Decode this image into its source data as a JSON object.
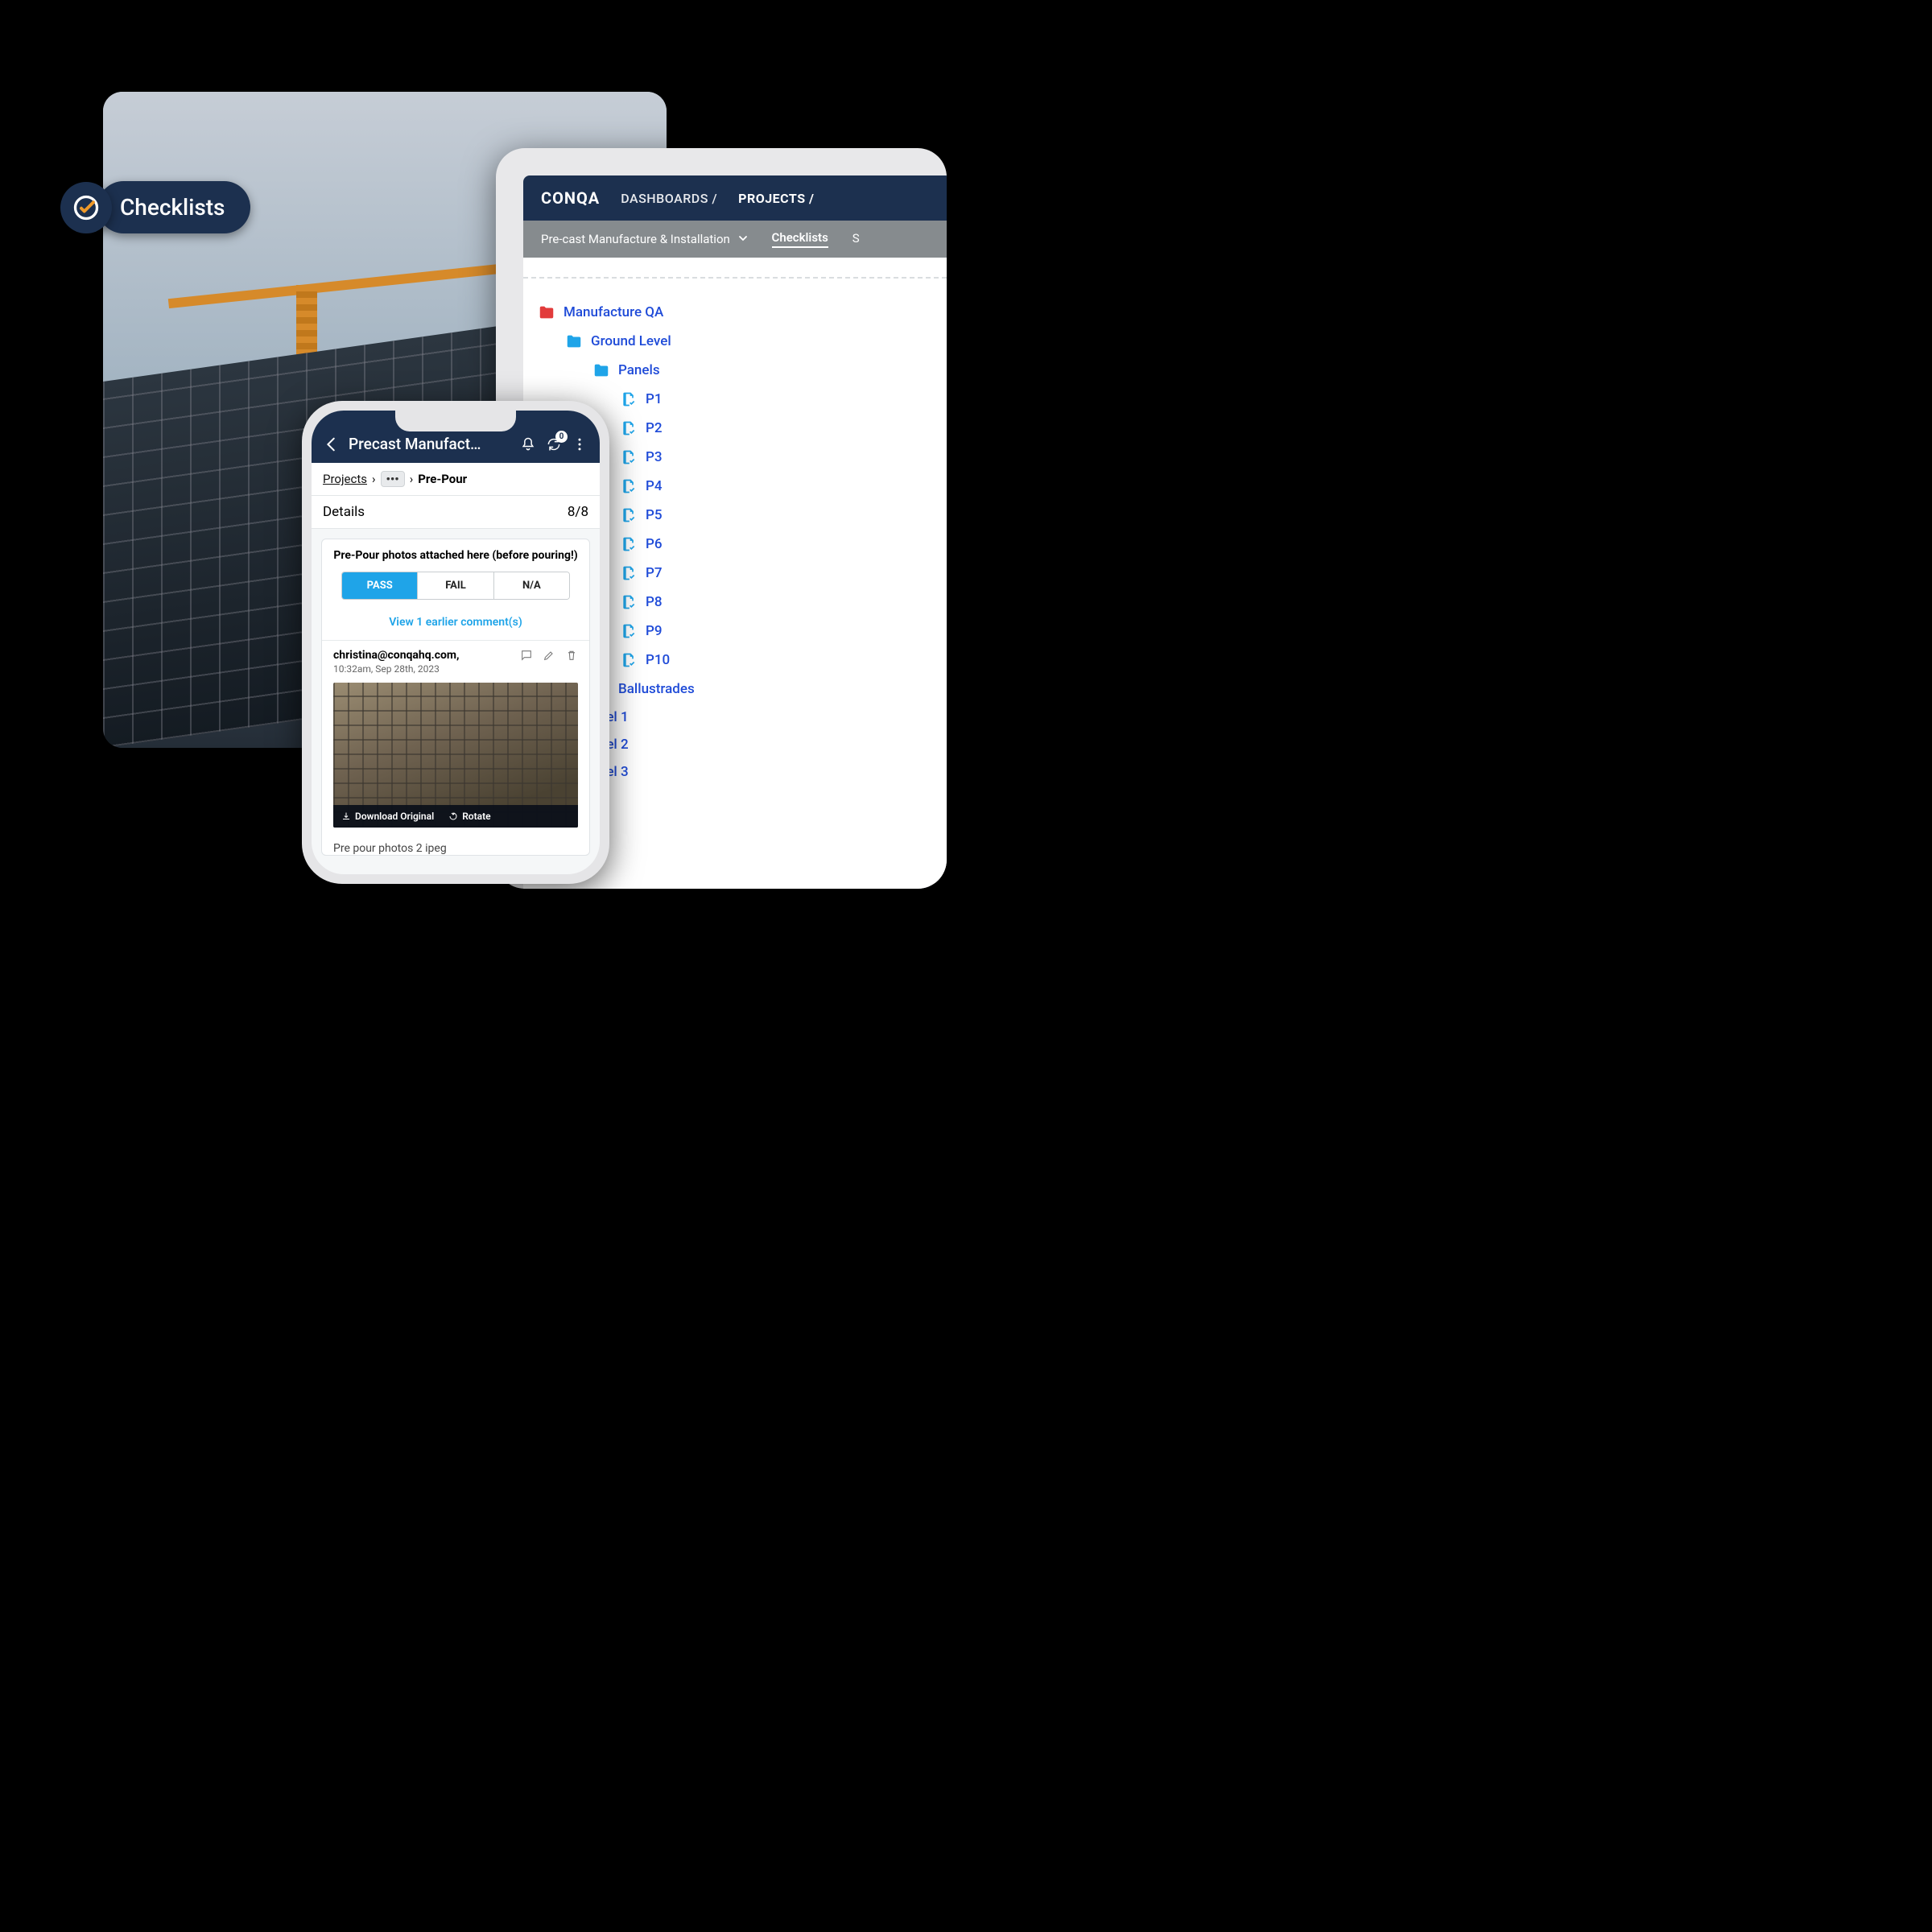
{
  "badge": {
    "label": "Checklists"
  },
  "tablet": {
    "logo": "CONQA",
    "nav": {
      "dashboards": "DASHBOARDS /",
      "projects": "PROJECTS /"
    },
    "subnav": {
      "project": "Pre-cast Manufacture & Installation",
      "tabs": {
        "checklists": "Checklists",
        "another": "S"
      }
    },
    "tree": {
      "root": "Manufacture QA",
      "level1": "Ground Level",
      "level2": "Panels",
      "items": [
        "P1",
        "P2",
        "P3",
        "P4",
        "P5",
        "P6",
        "P7",
        "P8",
        "P9",
        "P10"
      ],
      "sibling": "Ballustrades",
      "levels": [
        "evel 1",
        "evel 2",
        "evel 3"
      ]
    }
  },
  "phone": {
    "header": {
      "title": "Precast Manufact…",
      "sync_badge": "0"
    },
    "breadcrumb": {
      "root": "Projects",
      "current": "Pre-Pour"
    },
    "details": {
      "label": "Details",
      "count": "8/8"
    },
    "card": {
      "title": "Pre-Pour photos attached here (before pouring!)",
      "segments": {
        "pass": "PASS",
        "fail": "FAIL",
        "na": "N/A"
      },
      "view_earlier": "View 1 earlier comment(s)"
    },
    "comment": {
      "user": "christina@conqahq.com",
      "time": "10:32am, Sep 28th, 2023",
      "download": "Download Original",
      "rotate": "Rotate",
      "filename": "Pre pour photos 2 ipeg"
    }
  }
}
